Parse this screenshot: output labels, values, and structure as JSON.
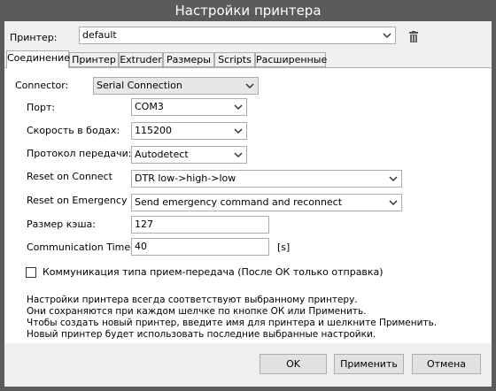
{
  "window": {
    "title": "Настройки принтера"
  },
  "printer": {
    "label": "Принтер:",
    "value": "default"
  },
  "tabs": [
    {
      "label": "Соединение",
      "active": true
    },
    {
      "label": "Принтер"
    },
    {
      "label": "Extruder"
    },
    {
      "label": "Размеры"
    },
    {
      "label": "Scripts"
    },
    {
      "label": "Расширенные"
    }
  ],
  "connector": {
    "label": "Connector:",
    "value": "Serial Connection"
  },
  "port": {
    "label": "Порт:",
    "value": "COM3"
  },
  "baud": {
    "label": "Скорость в бодах:",
    "value": "115200"
  },
  "protocol": {
    "label": "Протокол передачи:",
    "value": "Autodetect"
  },
  "reset_connect": {
    "label": "Reset on Connect",
    "value": "DTR low->high->low"
  },
  "reset_emergency": {
    "label": "Reset on Emergency",
    "value": "Send emergency command and reconnect"
  },
  "cache": {
    "label": "Размер кэша:",
    "value": "127"
  },
  "timeout": {
    "label": "Communication Timeout:",
    "value": "40",
    "unit": "[s]"
  },
  "pingpong": {
    "label": "Коммуникация типа прием-передача (После ОК только отправка)",
    "checked": false
  },
  "info": {
    "line1": "Настройки принтера всегда соответствуют выбранному принтеру.",
    "line2": "Они сохраняются при каждом шелчке по кнопке ОК или Применить.",
    "line3": "Чтобы создать новый принтер, введите имя для принтера и шелкните Применить.",
    "line4": "Новый принтер будет использовать последние выбранные настройки."
  },
  "buttons": {
    "ok": "OK",
    "apply": "Применить",
    "cancel": "Отмена"
  },
  "icons": {
    "delete": "trash-icon",
    "dropdown": "chevron-down-icon"
  }
}
